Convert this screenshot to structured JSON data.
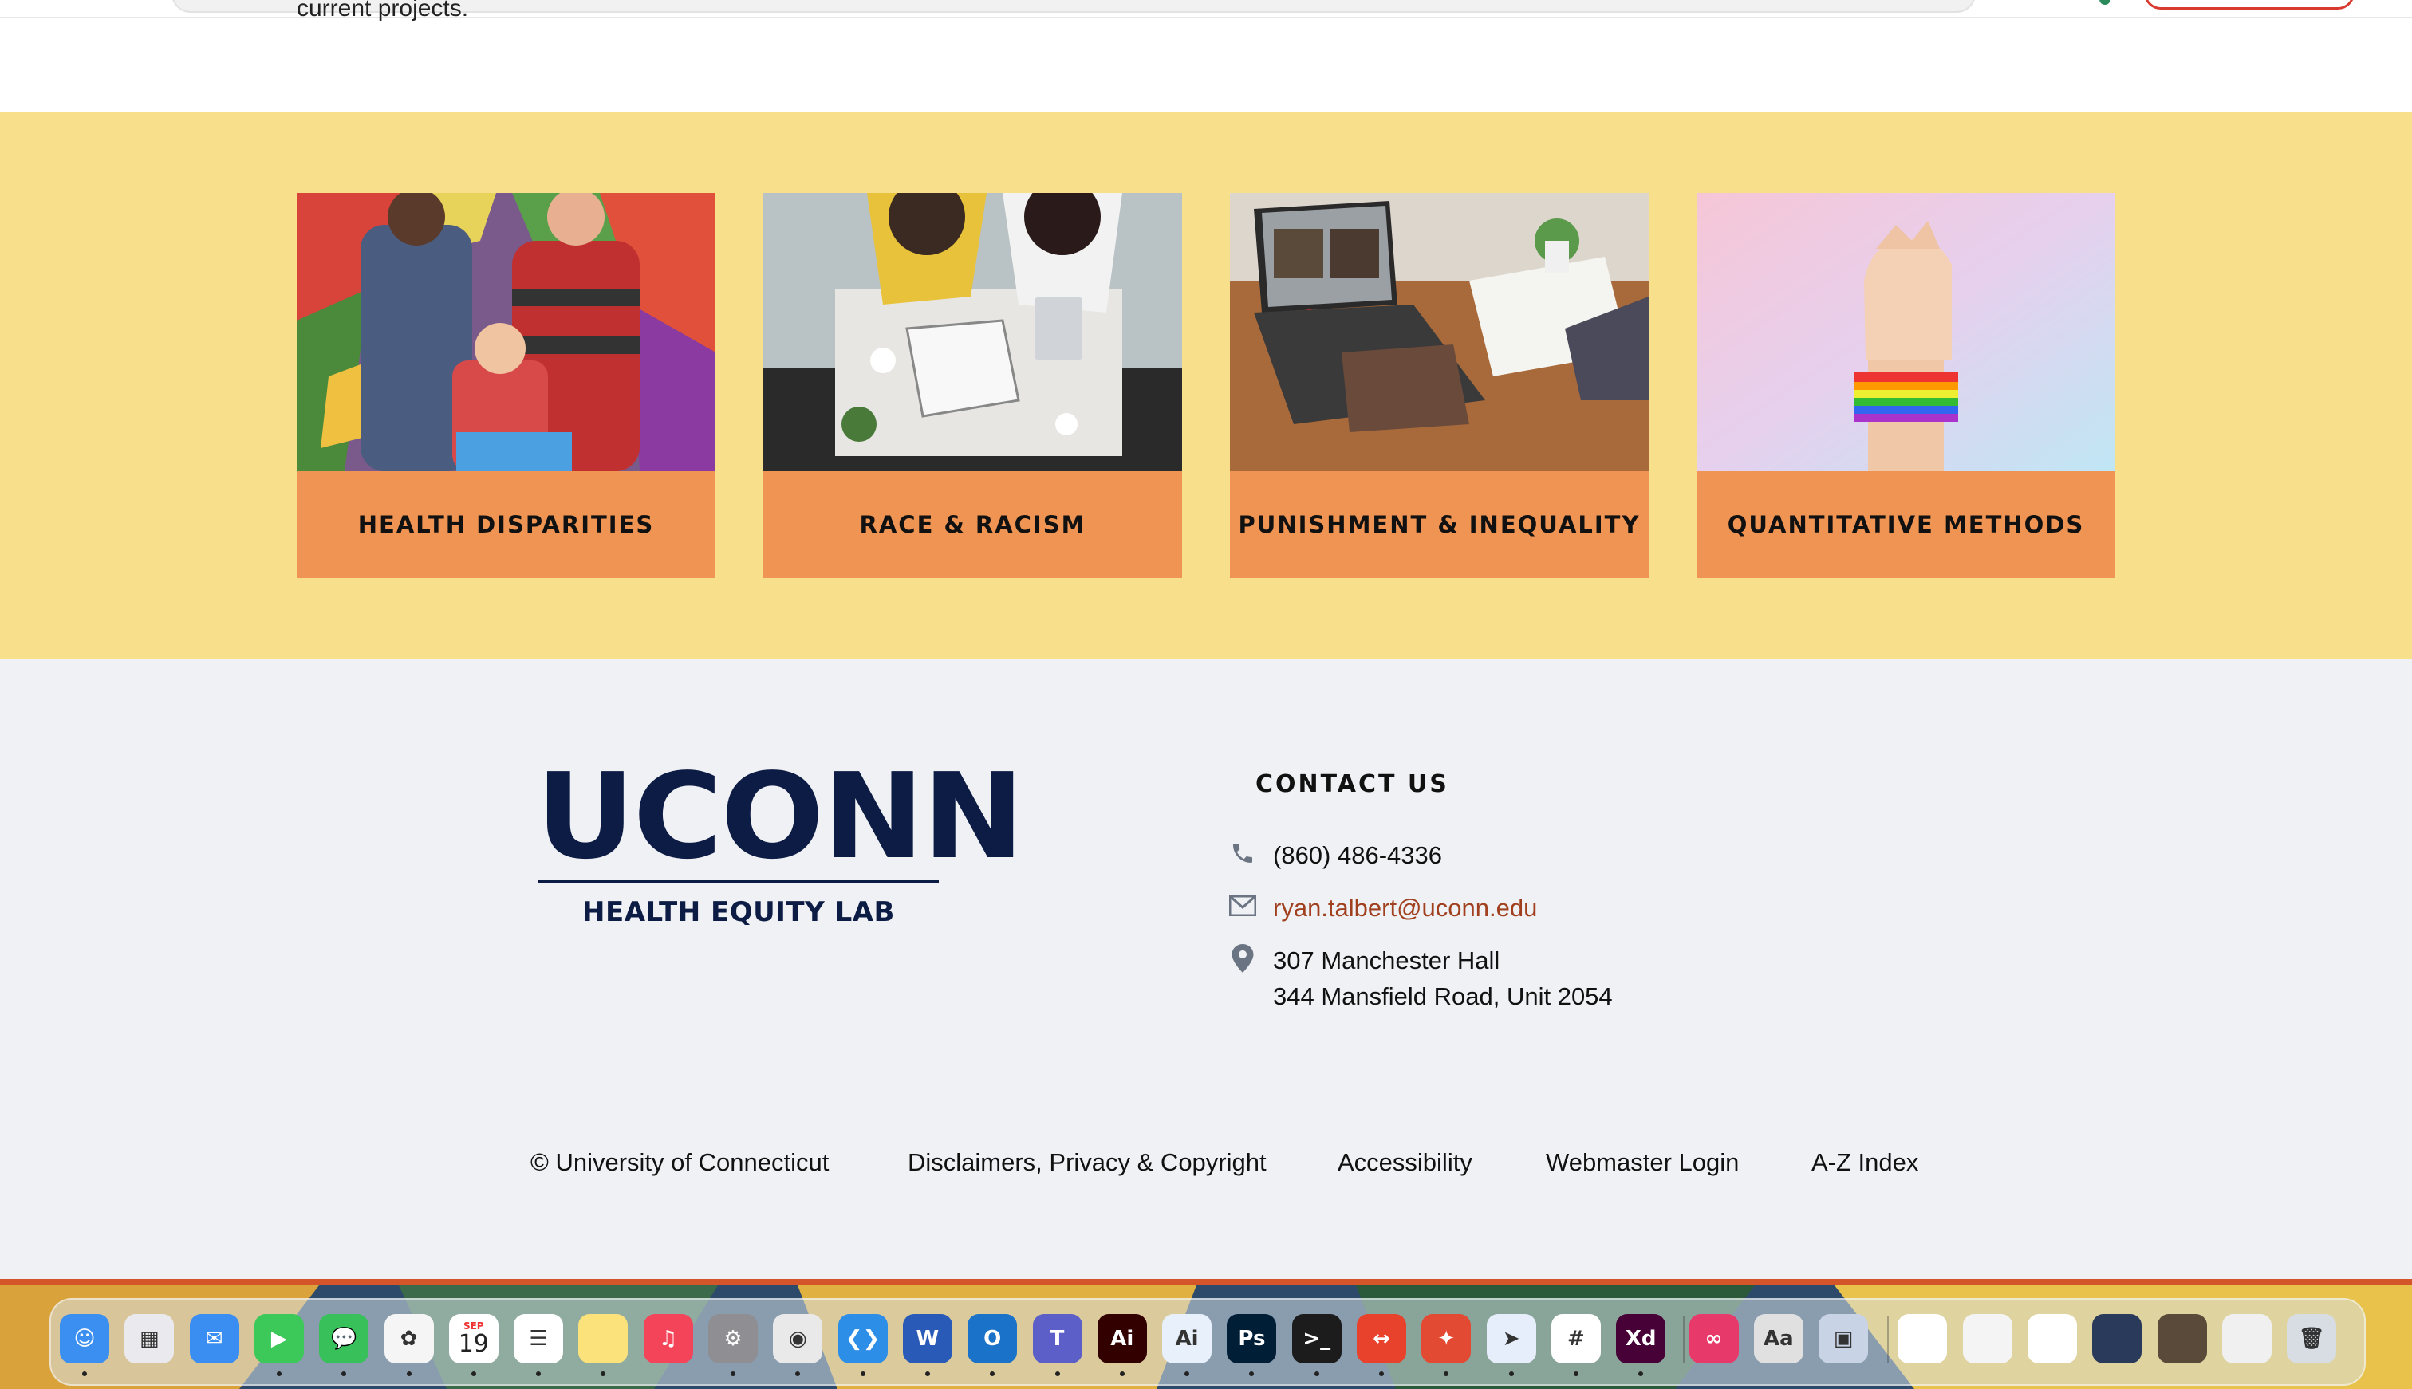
{
  "header": {
    "cut_text": "current projects."
  },
  "cards": [
    {
      "label": "HEALTH DISPARITIES"
    },
    {
      "label": "RACE & RACISM"
    },
    {
      "label": "PUNISHMENT & INEQUALITY"
    },
    {
      "label": "QUANTITATIVE METHODS"
    }
  ],
  "logo": {
    "wordmark": "UCONN",
    "subtitle": "HEALTH EQUITY LAB"
  },
  "contact": {
    "heading": "CONTACT US",
    "phone": "(860) 486-4336",
    "email": "ryan.talbert@uconn.edu",
    "address_line1": "307 Manchester Hall",
    "address_line2": "344 Mansfield Road, Unit 2054"
  },
  "legal": {
    "copyright": "© University of Connecticut",
    "disclaimers": "Disclaimers, Privacy & Copyright",
    "accessibility": "Accessibility",
    "webmaster": "Webmaster Login",
    "az_index": "A-Z Index"
  },
  "colors": {
    "yellow_band": "#f8df8c",
    "card_label_bg": "#ef9452",
    "footer_bg": "#f0f1f5",
    "navy": "#0c1c44",
    "link": "#a0401e"
  },
  "dock": {
    "calendar_month": "SEP",
    "calendar_day": "19",
    "apps": [
      {
        "name": "finder-icon",
        "glyph": "☺",
        "color": "#3b8ff0"
      },
      {
        "name": "launchpad-icon",
        "glyph": "▦",
        "color": "#e9e9ee"
      },
      {
        "name": "mail-icon",
        "glyph": "✉",
        "color": "#3a8ef2"
      },
      {
        "name": "facetime-icon",
        "glyph": "▶",
        "color": "#3dc85a"
      },
      {
        "name": "messages-icon",
        "glyph": "💬",
        "color": "#38c15a"
      },
      {
        "name": "photos-icon",
        "glyph": "✿",
        "color": "#f5f5f5"
      },
      {
        "name": "calendar-icon",
        "glyph": "",
        "color": "#ffffff"
      },
      {
        "name": "reminders-icon",
        "glyph": "☰",
        "color": "#ffffff"
      },
      {
        "name": "notes-icon",
        "glyph": "",
        "color": "#fbe27a"
      },
      {
        "name": "music-icon",
        "glyph": "♫",
        "color": "#f4445a"
      },
      {
        "name": "system-settings-icon",
        "glyph": "⚙",
        "color": "#8e8e93"
      },
      {
        "name": "chrome-icon",
        "glyph": "◉",
        "color": "#e9e9e9"
      },
      {
        "name": "vscode-icon",
        "glyph": "❮❯",
        "color": "#2d8ee8"
      },
      {
        "name": "word-icon",
        "glyph": "W",
        "color": "#2a5ab8"
      },
      {
        "name": "outlook-icon",
        "glyph": "O",
        "color": "#1a73c8"
      },
      {
        "name": "teams-icon",
        "glyph": "T",
        "color": "#5b5fc7"
      },
      {
        "name": "illustrator-icon",
        "glyph": "Ai",
        "color": "#330000"
      },
      {
        "name": "ai-app-icon",
        "glyph": "Ai",
        "color": "#e8f0fb"
      },
      {
        "name": "photoshop-icon",
        "glyph": "Ps",
        "color": "#001e36"
      },
      {
        "name": "terminal-icon",
        "glyph": ">_",
        "color": "#1c1c1c"
      },
      {
        "name": "remote-desktop-icon",
        "glyph": "↔",
        "color": "#e8412c"
      },
      {
        "name": "safari-icon",
        "glyph": "✦",
        "color": "#e24a33"
      },
      {
        "name": "power-automate-icon",
        "glyph": "➤",
        "color": "#e6eefb"
      },
      {
        "name": "slack-icon",
        "glyph": "#",
        "color": "#ffffff"
      },
      {
        "name": "xd-icon",
        "glyph": "Xd",
        "color": "#470137"
      },
      {
        "name": "creative-cloud-icon",
        "glyph": "∞",
        "color": "#e83a6a"
      },
      {
        "name": "font-book-icon",
        "glyph": "Aa",
        "color": "#e0e0e0"
      },
      {
        "name": "preview-icon",
        "glyph": "▣",
        "color": "#c8d4e6"
      },
      {
        "name": "window-thumb-1-icon",
        "glyph": "",
        "color": "#ffffff"
      },
      {
        "name": "window-thumb-2-icon",
        "glyph": "",
        "color": "#f4f4f4"
      },
      {
        "name": "window-thumb-3-icon",
        "glyph": "",
        "color": "#ffffff"
      },
      {
        "name": "window-thumb-4-icon",
        "glyph": "",
        "color": "#2a3a5a"
      },
      {
        "name": "window-thumb-5-icon",
        "glyph": "",
        "color": "#5a4a3a"
      },
      {
        "name": "window-thumb-6-icon",
        "glyph": "",
        "color": "#f0f0f0"
      },
      {
        "name": "trash-icon",
        "glyph": "🗑",
        "color": "#d8dde3"
      }
    ]
  }
}
